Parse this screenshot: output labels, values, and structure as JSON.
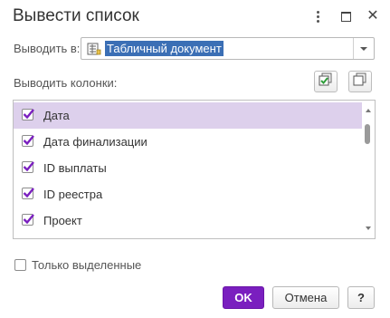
{
  "window": {
    "title": "Вывести список",
    "menu_icon": "more-vertical-icon",
    "maximize_icon": "maximize-icon",
    "close_icon": "close-icon",
    "close_glyph": "✕"
  },
  "output": {
    "label": "Выводить в:",
    "value": "Табличный документ",
    "value_icon": "spreadsheet-document-icon",
    "dropdown_icon": "chevron-down-icon"
  },
  "columns": {
    "label": "Выводить колонки:",
    "check_all_icon": "check-all-icon",
    "uncheck_all_icon": "uncheck-all-icon",
    "accent_color": "#7a1fbf",
    "selected_row_color": "#ddd0ec",
    "items": [
      {
        "label": "Дата",
        "checked": true,
        "selected": true
      },
      {
        "label": "Дата финализации",
        "checked": true,
        "selected": false
      },
      {
        "label": "ID выплаты",
        "checked": true,
        "selected": false
      },
      {
        "label": "ID реестра",
        "checked": true,
        "selected": false
      },
      {
        "label": "Проект",
        "checked": true,
        "selected": false
      }
    ]
  },
  "only_selected": {
    "label": "Только выделенные",
    "checked": false
  },
  "buttons": {
    "ok": "OK",
    "cancel": "Отмена",
    "help": "?"
  }
}
